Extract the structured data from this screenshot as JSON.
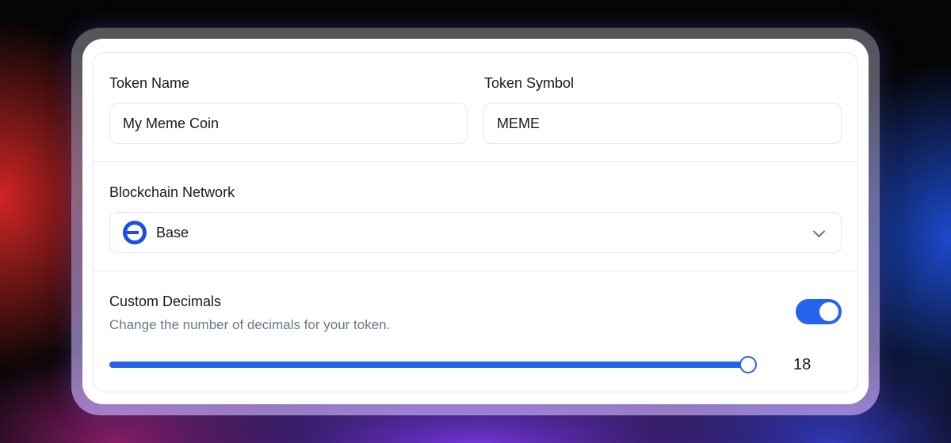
{
  "token_name": {
    "label": "Token Name",
    "value": "My Meme Coin"
  },
  "token_symbol": {
    "label": "Token Symbol",
    "value": "MEME"
  },
  "network": {
    "label": "Blockchain Network",
    "selected": "Base",
    "icon": "base-network-icon",
    "dropdown_icon": "chevron-down-icon"
  },
  "decimals": {
    "label": "Custom Decimals",
    "description": "Change the number of decimals for your token.",
    "enabled": true,
    "value": "18",
    "slider_fraction": 1.0
  },
  "colors": {
    "accent": "#2563eb",
    "network_icon": "#1d4fe6",
    "text": "#151a22",
    "muted_text": "#6b7789",
    "border": "#e3e7ee"
  }
}
